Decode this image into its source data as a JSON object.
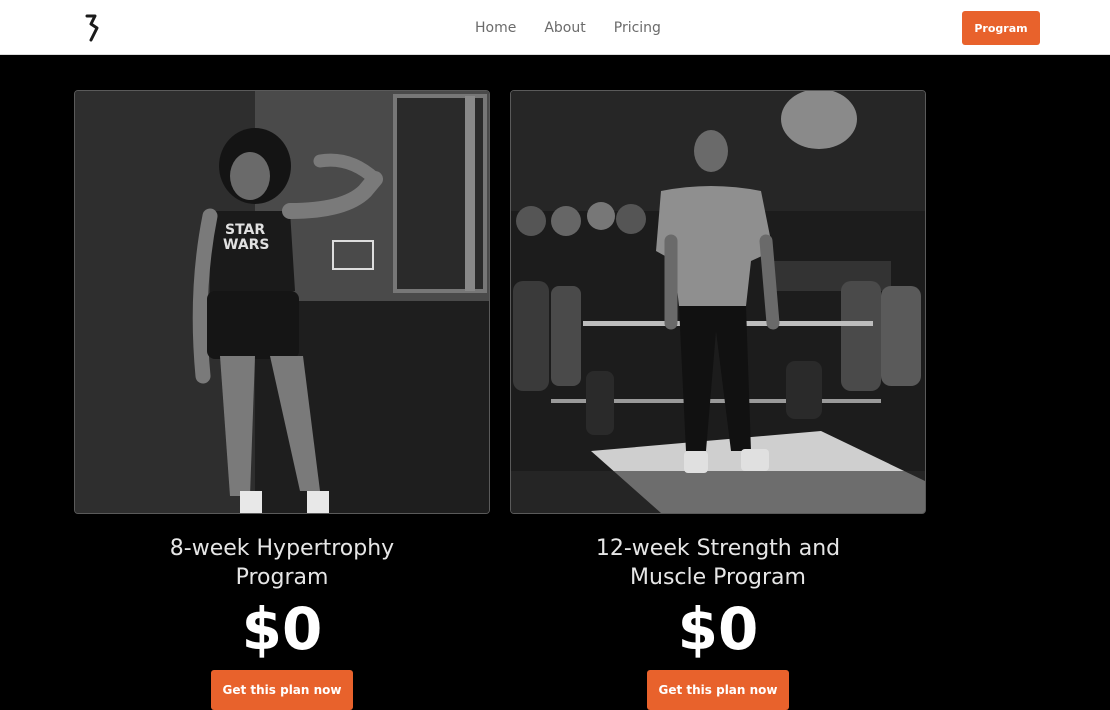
{
  "nav": {
    "links": [
      {
        "label": "Home"
      },
      {
        "label": "About"
      },
      {
        "label": "Pricing"
      }
    ],
    "cta_label": "Program"
  },
  "plans": [
    {
      "title": "8-week Hypertrophy Program",
      "price": "$0",
      "button_label": "Get this plan now",
      "photo_icon": "athlete-flex-photo"
    },
    {
      "title": "12-week Strength and Muscle Program",
      "price": "$0",
      "button_label": "Get this plan now",
      "photo_icon": "athlete-deadlift-photo"
    }
  ],
  "colors": {
    "accent": "#e8622c",
    "background": "#000000",
    "navbar": "#ffffff"
  }
}
